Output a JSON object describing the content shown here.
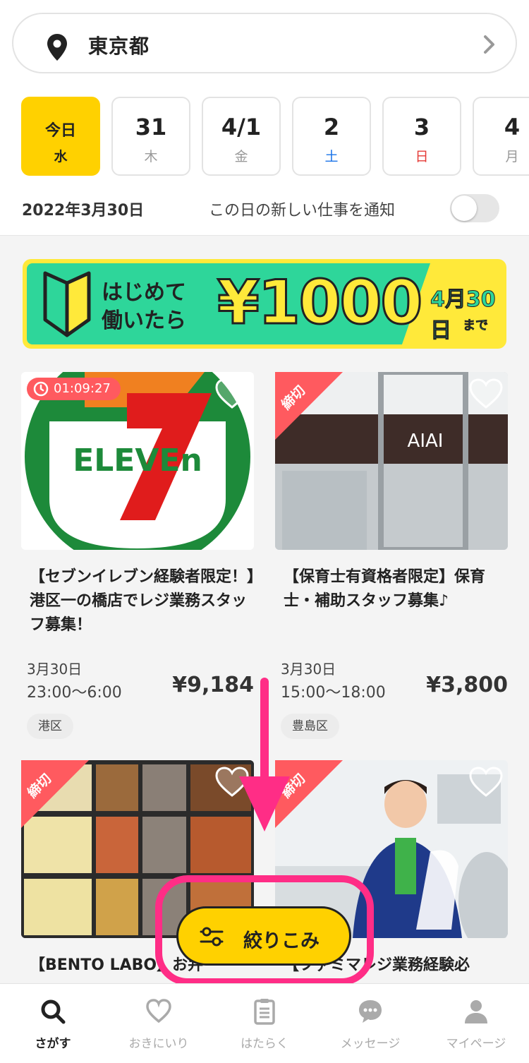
{
  "location": {
    "name": "東京都",
    "pin_icon": "map-pin-icon",
    "chevron_icon": "chevron-right-icon"
  },
  "dates": [
    {
      "day": "今日",
      "weekday": "水",
      "active": true
    },
    {
      "day": "31",
      "weekday": "木"
    },
    {
      "day": "4/1",
      "weekday": "金"
    },
    {
      "day": "2",
      "weekday": "土",
      "type": "sat"
    },
    {
      "day": "3",
      "weekday": "日",
      "type": "sun"
    },
    {
      "day": "4",
      "weekday": "月"
    }
  ],
  "selected_date": "2022年3月30日",
  "notify": {
    "label": "この日の新しい仕事を通知",
    "enabled": false
  },
  "banner": {
    "line1": "はじめて",
    "line2": "働いたら",
    "amount": "¥1000",
    "deadline": "4月30日",
    "until": "まで",
    "colors": {
      "yellow": "#ffe93a",
      "green": "#2ed69a"
    }
  },
  "jobs": [
    {
      "title": "【セブンイレブン経験者限定！】港区一の橋店でレジ業務スタッフ募集！",
      "date": "3月30日",
      "time": "23:00〜6:00",
      "price": "¥9,184",
      "area": "港区",
      "timer": "01:09:27"
    },
    {
      "title": "【保育士有資格者限定】保育士・補助スタッフ募集♪",
      "date": "3月30日",
      "time": "15:00〜18:00",
      "price": "¥3,800",
      "area": "豊島区",
      "closed_label": "締切",
      "image_text": "AIAI"
    },
    {
      "title": "【BENTO LABO】お弁",
      "closed_label": "締切"
    },
    {
      "title": "【ファミマレジ業務経験必",
      "closed_label": "締切"
    }
  ],
  "filter_button": {
    "label": "絞りこみ",
    "icon": "filter-sliders-icon"
  },
  "tabs": [
    {
      "label": "さがす",
      "icon": "search-icon",
      "active": true
    },
    {
      "label": "おきにいり",
      "icon": "heart-icon"
    },
    {
      "label": "はたらく",
      "icon": "clipboard-icon"
    },
    {
      "label": "メッセージ",
      "icon": "chat-bubble-icon"
    },
    {
      "label": "マイページ",
      "icon": "person-icon"
    }
  ],
  "colors": {
    "accent": "#ffd100",
    "closed": "#ff5a5f",
    "highlight": "#ff2d86"
  }
}
